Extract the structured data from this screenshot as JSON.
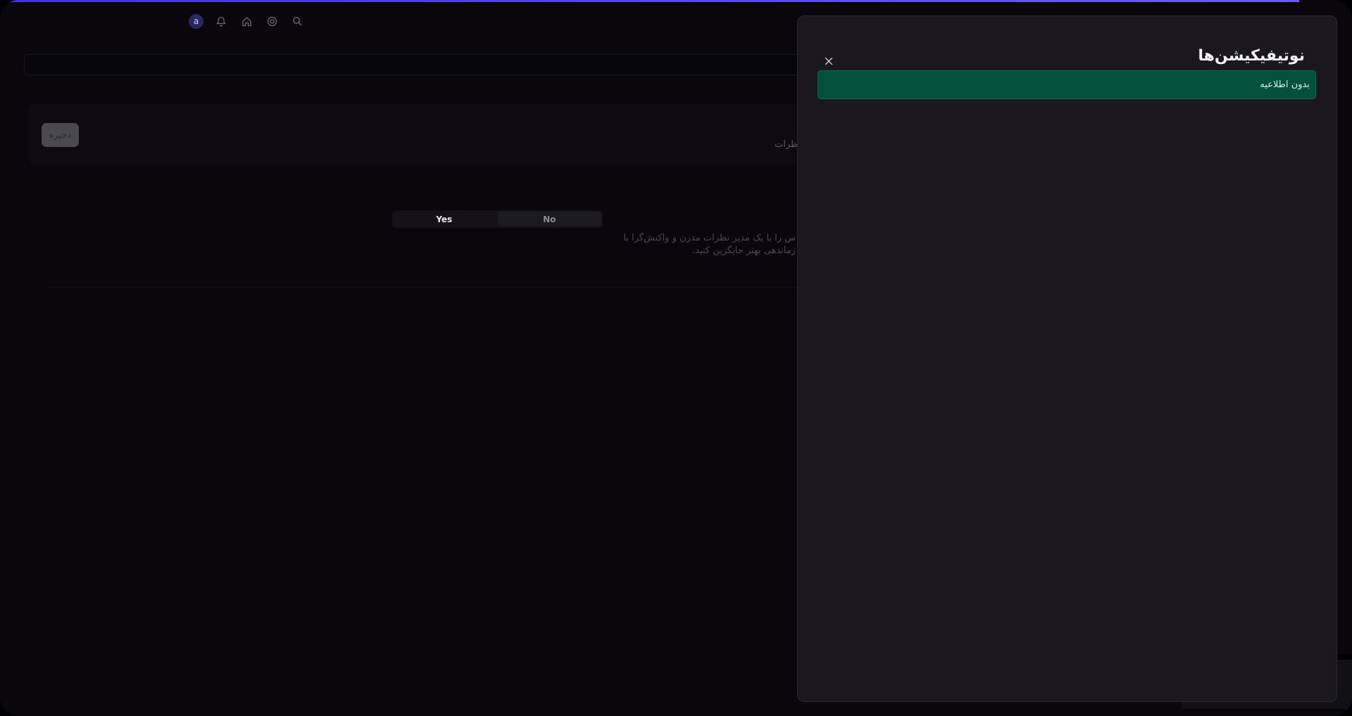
{
  "topbar": {
    "avatar_letter": "a",
    "icons": [
      "avatar-icon",
      "bell-icon",
      "home-icon",
      "support-icon",
      "search-icon"
    ]
  },
  "settings": {
    "save_label": "ذخیره",
    "section_label": "ظرات",
    "toggle": {
      "yes_label": "Yes",
      "no_label": "No",
      "selected": "Yes"
    },
    "description_line1": "س را با یک مدیر نظرات مدرن و واکنش‌گرا با",
    "description_line2": "زماندهی بهتر جایگزین کنید."
  },
  "drawer": {
    "title": "نوتیفیکیشن‌ها",
    "empty_message": "بدون اطلاعیه"
  },
  "colors": {
    "accent": "#3f35d8",
    "notice_bg": "#03503f",
    "drawer_bg": "#1a181e",
    "page_bg": "#09070c"
  }
}
